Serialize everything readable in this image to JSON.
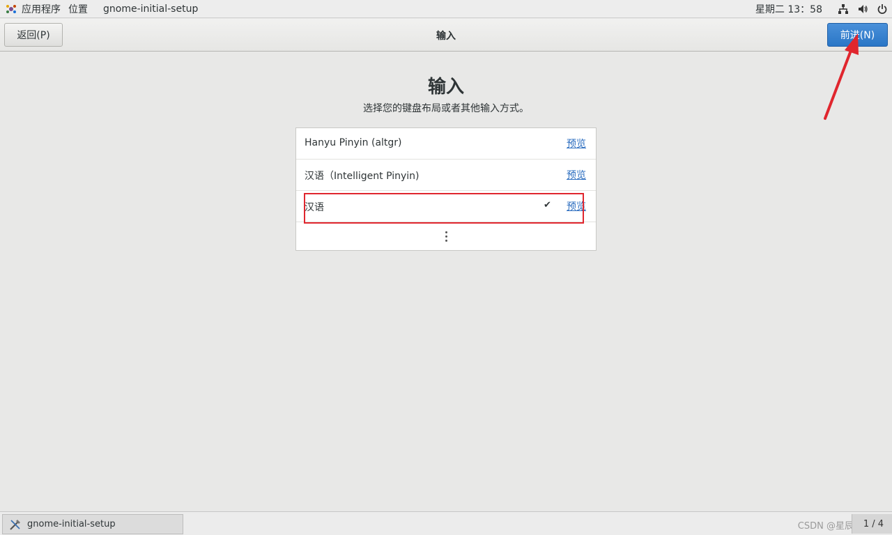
{
  "top_panel": {
    "apps_menu": "应用程序",
    "places_menu": "位置",
    "window_title": "gnome-initial-setup",
    "clock": "星期二 13：58",
    "icons": [
      "network-icon",
      "volume-icon",
      "power-icon"
    ]
  },
  "header": {
    "back_label": "返回(P)",
    "title": "输入",
    "next_label": "前进(N)"
  },
  "main": {
    "title": "输入",
    "subtitle": "选择您的键盘布局或者其他输入方式。",
    "sources": [
      {
        "label": "Hanyu Pinyin (altgr)",
        "preview": "预览",
        "selected": false
      },
      {
        "label": "汉语（Intelligent Pinyin)",
        "preview": "预览",
        "selected": false
      },
      {
        "label": "汉语",
        "preview": "预览",
        "selected": true,
        "check": "✔"
      }
    ],
    "more_icon": "more-vertical-icon"
  },
  "taskbar": {
    "task_label": "gnome-initial-setup",
    "watermark": "CSDN @星辰仲",
    "pager": "1 / 4"
  },
  "colors": {
    "accent": "#2a76c6",
    "link": "#2a6cbf",
    "annotation": "#e0262e"
  }
}
